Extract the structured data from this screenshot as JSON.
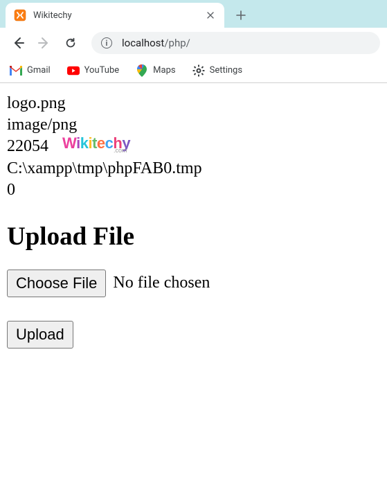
{
  "tab": {
    "title": "Wikitechy"
  },
  "address": {
    "host": "localhost",
    "path": "/php/"
  },
  "bookmarks": {
    "gmail": "Gmail",
    "youtube": "YouTube",
    "maps": "Maps",
    "settings": "Settings"
  },
  "output": {
    "filename": "logo.png",
    "mimetype": "image/png",
    "size": "22054",
    "tmppath": "C:\\xampp\\tmp\\phpFAB0.tmp",
    "errorcode": "0"
  },
  "watermark": {
    "text": "Wikitechy",
    "sub": ".com"
  },
  "form": {
    "heading": "Upload File",
    "choose_label": "Choose File",
    "no_file_text": "No file chosen",
    "upload_label": "Upload"
  }
}
